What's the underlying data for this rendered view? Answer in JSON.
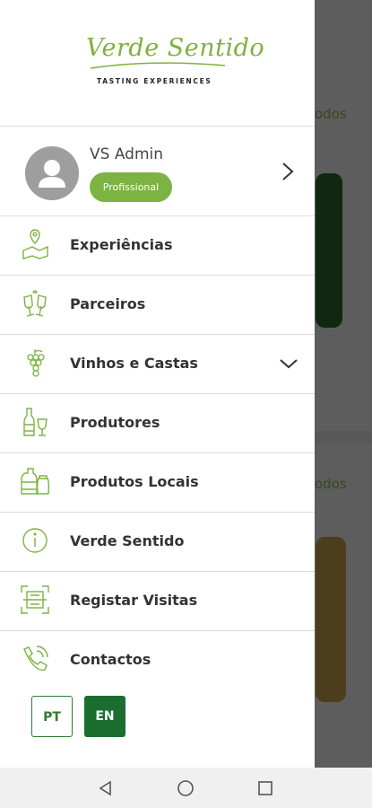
{
  "background": {
    "todos_top": "todos",
    "todos_bottom": "todos"
  },
  "drawer": {
    "logo": {
      "script": "Verde Sentido",
      "subtitle": "TASTING EXPERIENCES"
    },
    "profile": {
      "name": "VS Admin",
      "badge": "Profissional"
    },
    "menu": [
      {
        "label": "Experiências",
        "icon": "map-pin-icon"
      },
      {
        "label": "Parceiros",
        "icon": "cheers-icon"
      },
      {
        "label": "Vinhos e Castas",
        "icon": "grapes-icon"
      },
      {
        "label": "Produtores",
        "icon": "wine-bottle-icon"
      },
      {
        "label": "Produtos Locais",
        "icon": "jars-icon"
      },
      {
        "label": "Verde Sentido",
        "icon": "info-icon"
      },
      {
        "label": "Registar Visitas",
        "icon": "qr-scan-icon"
      },
      {
        "label": "Contactos",
        "icon": "phone-icon"
      }
    ],
    "languages": {
      "pt": "PT",
      "en": "EN",
      "selected": "EN"
    }
  },
  "colors": {
    "brand_green": "#7cb342",
    "dark_green": "#1b6e2f",
    "icon_green": "#7cb342"
  }
}
